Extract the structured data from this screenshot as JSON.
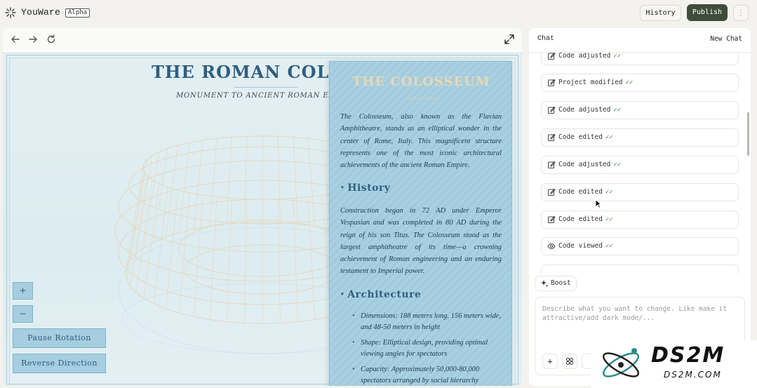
{
  "app": {
    "title": "YouWare",
    "badge": "Alpha"
  },
  "header": {
    "history_label": "History",
    "publish_label": "Publish",
    "more_label": "⋮"
  },
  "site": {
    "title": "THE ROMAN COLOSS",
    "subtitle": "MONUMENT TO ANCIENT ROMAN ENGINEE",
    "zoom_in_label": "+",
    "zoom_out_label": "−",
    "pause_label": "Pause Rotation",
    "reverse_label": "Reverse Direction"
  },
  "info": {
    "title": "THE COLOSSEUM",
    "intro": "The Colosseum, also known as the Flavian Amphitheatre, stands as an elliptical wonder in the center of Rome, Italy. This magnificent structure represents one of the most iconic architectural achievements of the ancient Roman Empire.",
    "history_heading": "History",
    "history_text": "Construction began in 72 AD under Emperor Vespasian and was completed in 80 AD during the reign of his son Titus. The Colosseum stood as the largest amphitheatre of its time—a crowning achievement of Roman engineering and an enduring testament to Imperial power.",
    "architecture_heading": "Architecture",
    "architecture_items": [
      "Dimensions: 188 meters long, 156 meters wide, and 48-50 meters in height",
      "Shape: Elliptical design, providing optimal viewing angles for spectators",
      "Capacity: Approximately 50,000-80,000 spectators arranged by social hierarchy"
    ]
  },
  "chat": {
    "title": "Chat",
    "new_chat_label": "New Chat",
    "messages": [
      {
        "label": "Code adjusted",
        "icon": "edit-icon"
      },
      {
        "label": "Project modified",
        "icon": "edit-icon"
      },
      {
        "label": "Code adjusted",
        "icon": "edit-icon"
      },
      {
        "label": "Code edited",
        "icon": "edit-icon"
      },
      {
        "label": "Code adjusted",
        "icon": "edit-icon"
      },
      {
        "label": "Code edited",
        "icon": "edit-icon"
      },
      {
        "label": "Code edited",
        "icon": "edit-icon"
      },
      {
        "label": "Code viewed",
        "icon": "eye-icon"
      }
    ],
    "check_mark": "✓✓",
    "boost_label": "Boost",
    "input_placeholder": "Describe what you want to change. Like make it attractive/add dark mode/...",
    "add_label": "+"
  },
  "watermark": {
    "name": "DS2M",
    "url": "DS2M.COM"
  },
  "colors": {
    "publish_bg": "#3e4d3a",
    "site_bg": "#dcecf0",
    "panel_bg": "#a9d1e2",
    "title_blue": "#2f5f80",
    "gold": "#e9d8b0",
    "check_green": "#3b8a3b"
  }
}
